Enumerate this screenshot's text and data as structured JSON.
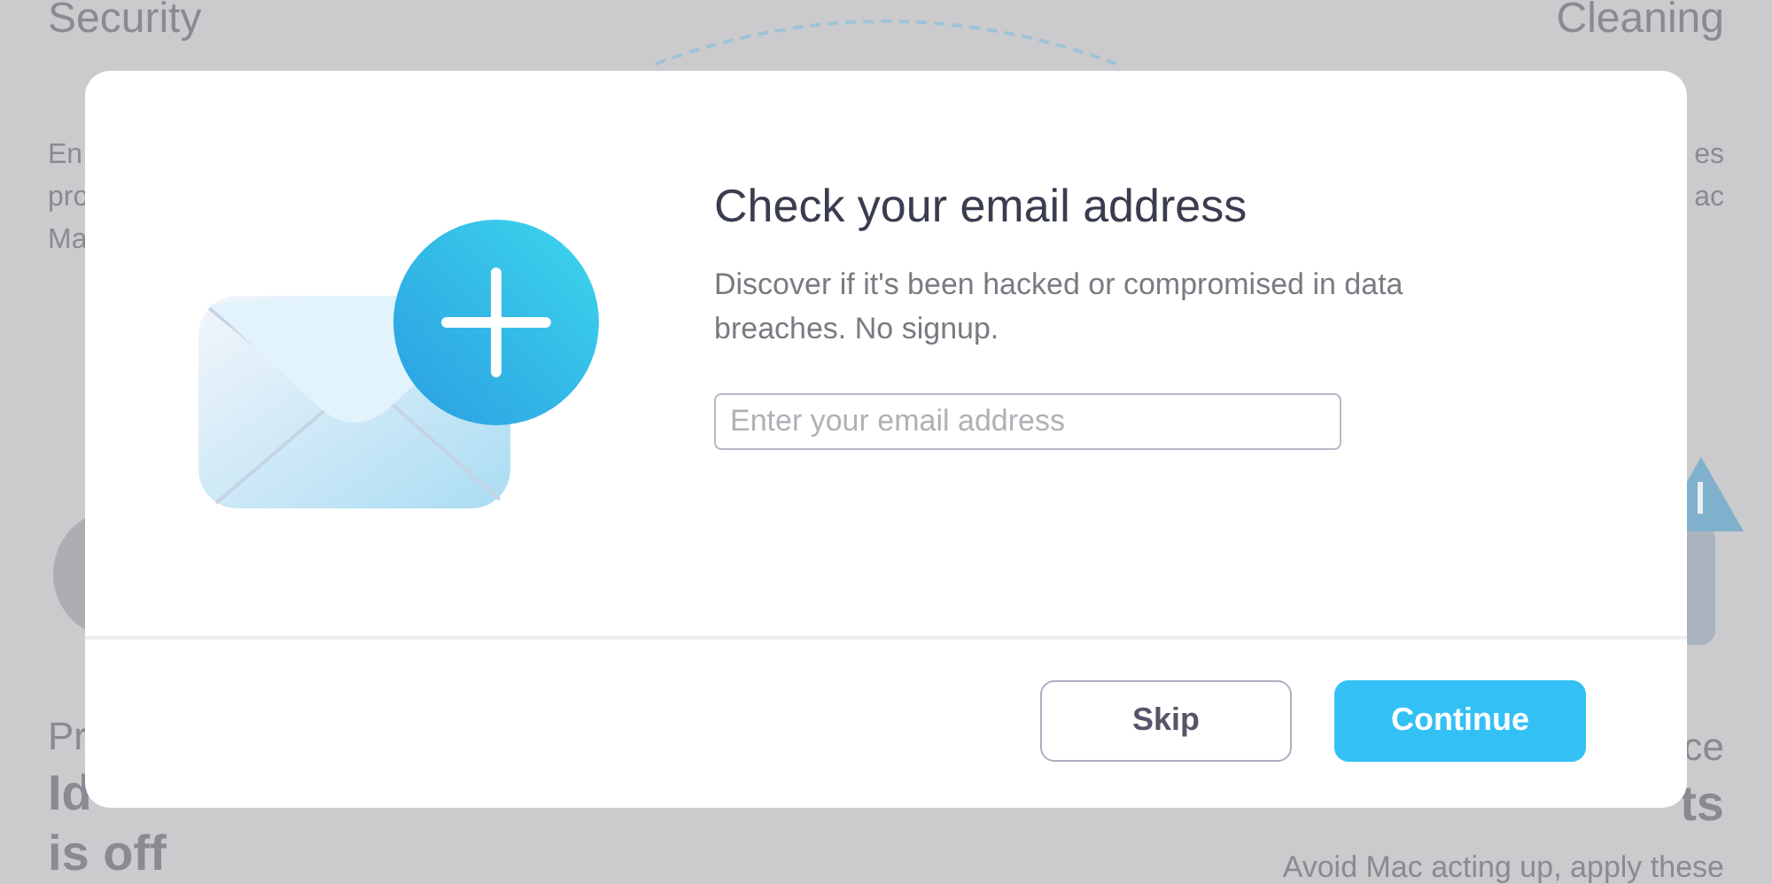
{
  "background": {
    "left": {
      "title": "Security",
      "description_lines": [
        "En",
        "pro",
        "Ma"
      ],
      "card_title": "Pr",
      "card_status_lines": [
        "Id",
        "is off"
      ]
    },
    "right": {
      "title": "Cleaning",
      "description_lines": [
        "es",
        "ac"
      ],
      "card_title": "ce",
      "card_status_lines": [
        "ts"
      ],
      "card_description": "Avoid Mac acting up, apply these"
    }
  },
  "dialog": {
    "title": "Check your email address",
    "description": "Discover if it's been hacked or compromised in data breaches. No signup.",
    "email_field": {
      "placeholder": "Enter your email address"
    },
    "buttons": [
      {
        "label": "Skip",
        "kind": "secondary"
      },
      {
        "label": "Continue",
        "kind": "primary"
      }
    ]
  }
}
